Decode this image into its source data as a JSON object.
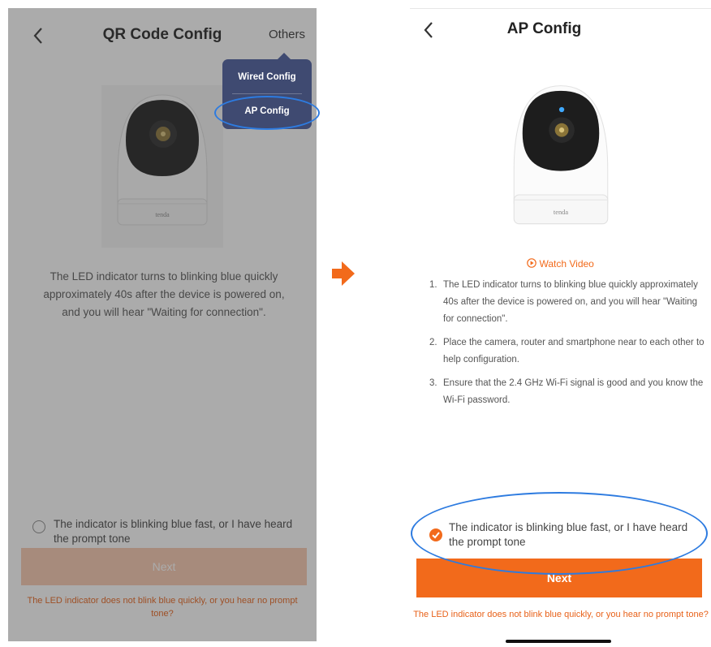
{
  "left_screen": {
    "title": "QR Code Config",
    "back_icon": "chevron-left-icon",
    "others_label": "Others",
    "menu": {
      "items": [
        "Wired Config",
        "AP Config"
      ],
      "highlighted": "AP Config",
      "background": "#3f4a71"
    },
    "camera_brand": "tenda",
    "description": "The LED indicator turns to blinking blue quickly approximately 40s after the device is powered on, and you will hear \"Waiting for connection\".",
    "checkbox_label": "The indicator is blinking blue fast, or I have heard the prompt tone",
    "checkbox_checked": false,
    "next_label": "Next",
    "next_enabled": false,
    "help_text": "The LED indicator does not blink blue quickly, or you hear no prompt tone?"
  },
  "arrow_color": "#f26a1b",
  "right_screen": {
    "title": "AP Config",
    "back_icon": "chevron-left-icon",
    "camera_brand": "tenda",
    "watch_video_label": "Watch Video",
    "steps": [
      {
        "num": "1.",
        "text": "The LED indicator turns to blinking blue quickly approximately 40s after the device is powered on, and you will hear \"Waiting for connection\"."
      },
      {
        "num": "2.",
        "text": "Place the camera, router and smartphone near to each other to help configuration."
      },
      {
        "num": "3.",
        "text": "Ensure that the 2.4 GHz Wi-Fi signal is good and you know the Wi-Fi password."
      }
    ],
    "checkbox_label": "The indicator is blinking blue fast, or I have heard the prompt tone",
    "checkbox_checked": true,
    "next_label": "Next",
    "next_enabled": true,
    "help_text": "The LED indicator does not blink blue quickly, or you hear no prompt tone?"
  },
  "colors": {
    "accent": "#f26a1b",
    "highlight_ring": "#2d7be0",
    "dim_overlay": "#5a5a5a"
  }
}
